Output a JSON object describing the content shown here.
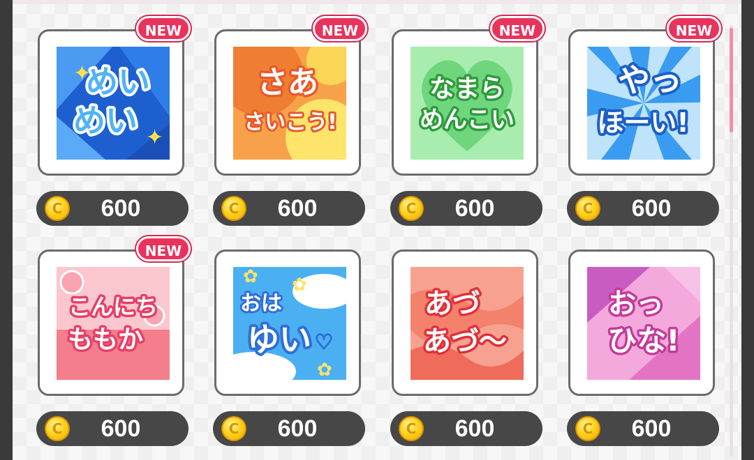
{
  "badge_label": "NEW",
  "coin_glyph": "C",
  "items": [
    {
      "id": "meimei",
      "line1": "めい",
      "line2": "めい",
      "price": "600",
      "new": true,
      "colors": {
        "bg": "#2c6fd6",
        "text": "#4fb3f7",
        "stroke": "#ffffff"
      }
    },
    {
      "id": "saa",
      "line1": "さあ",
      "line2": "さいこう!",
      "price": "600",
      "new": true,
      "colors": {
        "bg": "#f58b3c",
        "text": "#ffffff",
        "stroke": "#e85a2a"
      }
    },
    {
      "id": "namara",
      "line1": "なまら",
      "line2": "めんこい",
      "price": "600",
      "new": true,
      "colors": {
        "bg": "#86e08f",
        "text": "#ffffff",
        "stroke": "#2e9b3c"
      }
    },
    {
      "id": "yahho",
      "line1": "やっ",
      "line2": "ほーい!",
      "price": "600",
      "new": true,
      "colors": {
        "bg": "#3a9cf0",
        "text": "#ffffff",
        "stroke": "#1c5fc7"
      }
    },
    {
      "id": "konnichi",
      "line1": "こんにち",
      "line2": "ももか",
      "price": "600",
      "new": true,
      "colors": {
        "bg": "#f48a9a",
        "text": "#ffffff",
        "stroke": "#e83f66"
      }
    },
    {
      "id": "ohayui",
      "line1": "おは",
      "line2": "ゆい",
      "price": "600",
      "new": false,
      "colors": {
        "bg": "#4ab0f2",
        "text": "#ffffff",
        "stroke": "#2f6fd8"
      }
    },
    {
      "id": "agu",
      "line1": "あづ",
      "line2": "あづ〜",
      "price": "600",
      "new": false,
      "colors": {
        "bg": "#f3816c",
        "text": "#ffffff",
        "stroke": "#e0303a"
      }
    },
    {
      "id": "ottsu",
      "line1": "おっ",
      "line2": "ひな!",
      "price": "600",
      "new": false,
      "colors": {
        "bg": "#e374c4",
        "text": "#ffffff",
        "stroke": "#c43b9a"
      }
    }
  ]
}
